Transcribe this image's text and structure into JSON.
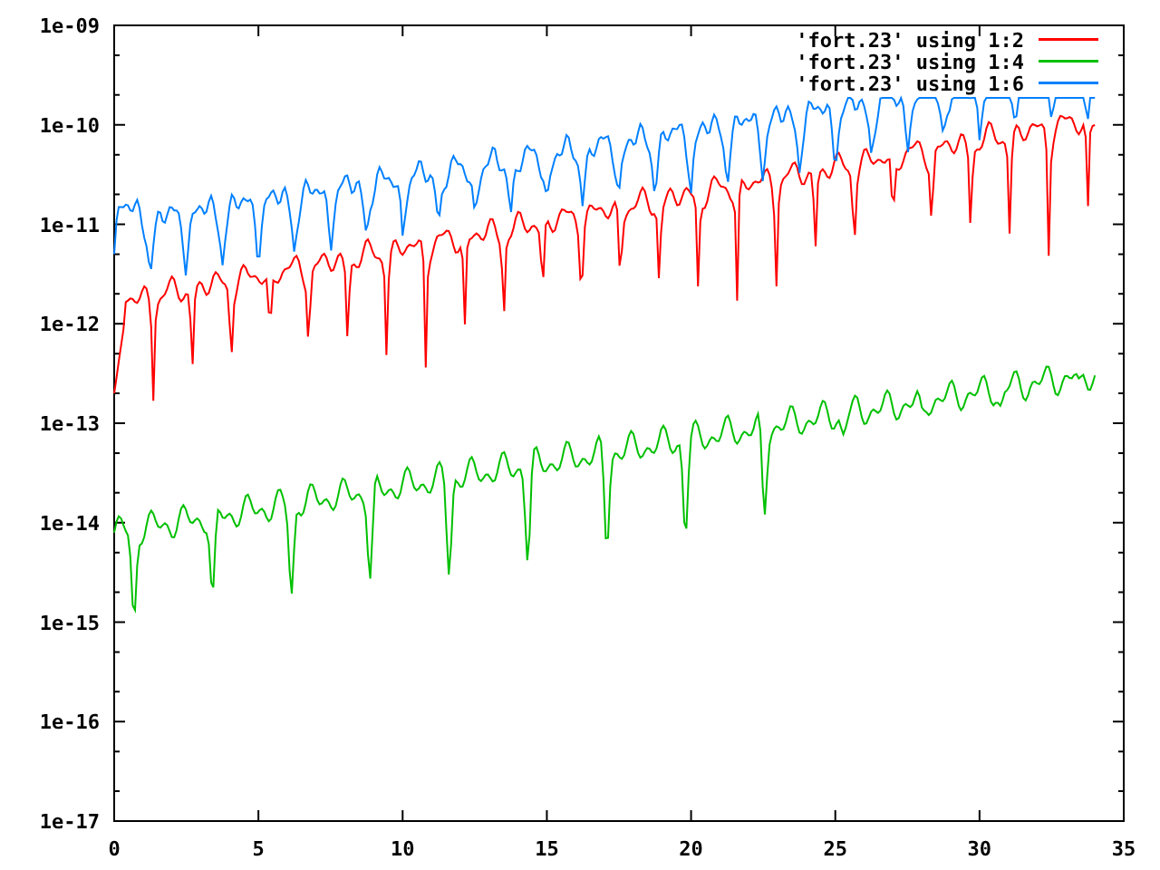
{
  "plot": {
    "y_axis_labels": [
      "1e-09",
      "1e-10",
      "1e-11",
      "1e-12",
      "1e-13",
      "1e-14",
      "1e-15",
      "1e-16",
      "1e-17"
    ],
    "x_axis_labels": [
      "0",
      "5",
      "10",
      "15",
      "20",
      "25",
      "30",
      "35"
    ],
    "legend": [
      {
        "label": "'fort.23' using 1:2",
        "color": "#ff0000"
      },
      {
        "label": "'fort.23' using 1:4",
        "color": "#00c000"
      },
      {
        "label": "'fort.23' using 1:6",
        "color": "#0080ff"
      }
    ]
  }
}
